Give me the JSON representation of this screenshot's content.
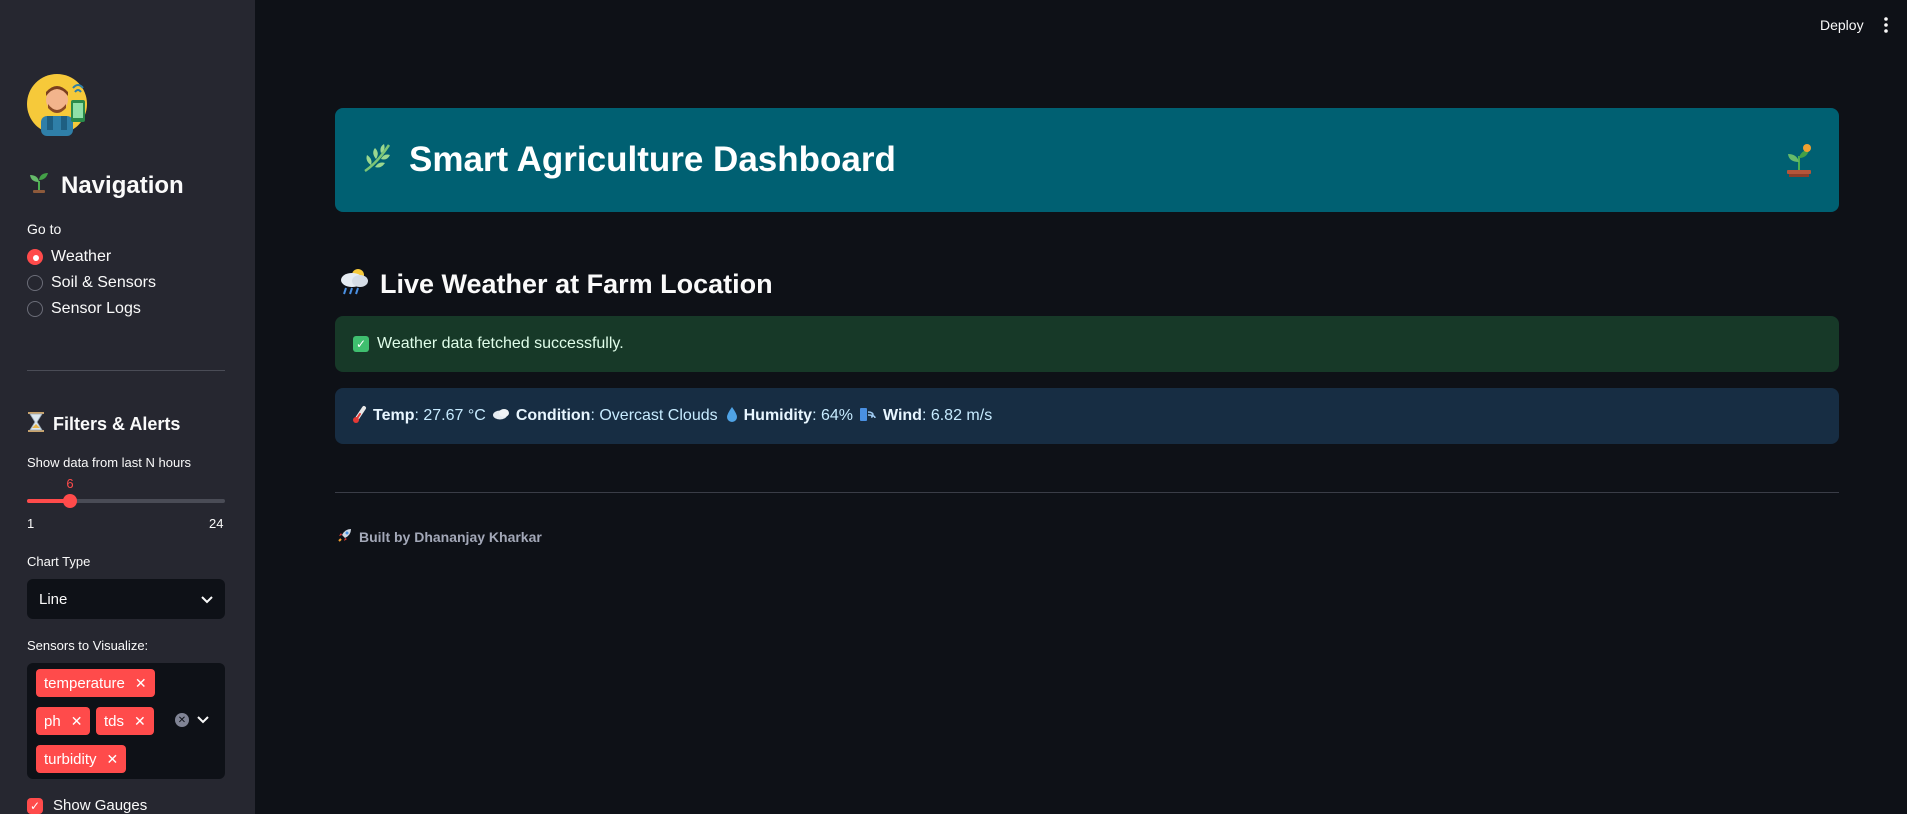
{
  "topbar": {
    "deploy_label": "Deploy",
    "menu_icon": "kebab-menu-icon"
  },
  "sidebar": {
    "avatar_icon": "farmer-avatar-icon",
    "nav_heading": "Navigation",
    "goto_label": "Go to",
    "nav_options": [
      {
        "label": "Weather",
        "selected": true
      },
      {
        "label": "Soil & Sensors",
        "selected": false
      },
      {
        "label": "Sensor Logs",
        "selected": false
      }
    ],
    "filters_heading": "Filters & Alerts",
    "hours_slider": {
      "label": "Show data from last N hours",
      "value": "6",
      "min": "1",
      "max": "24"
    },
    "chart_type": {
      "label": "Chart Type",
      "selected": "Line"
    },
    "sensors": {
      "label": "Sensors to Visualize:",
      "tags": [
        "temperature",
        "ph",
        "tds",
        "turbidity"
      ]
    },
    "show_gauges": {
      "label": "Show Gauges",
      "checked": true
    }
  },
  "main": {
    "banner_title": "Smart Agriculture Dashboard",
    "section_title": "Live Weather at Farm Location",
    "success_message": "Weather data fetched successfully.",
    "weather": {
      "temp_label": "Temp",
      "temp_value": "27.67 °C",
      "condition_label": "Condition",
      "condition_value": "Overcast Clouds",
      "humidity_label": "Humidity",
      "humidity_value": "64%",
      "wind_label": "Wind",
      "wind_value": "6.82 m/s"
    },
    "footer": "Built by Dhananjay Kharkar"
  },
  "colors": {
    "accent": "#ff4b4b",
    "banner": "#006072",
    "success_bg": "#173928",
    "info_bg": "#172d43"
  }
}
